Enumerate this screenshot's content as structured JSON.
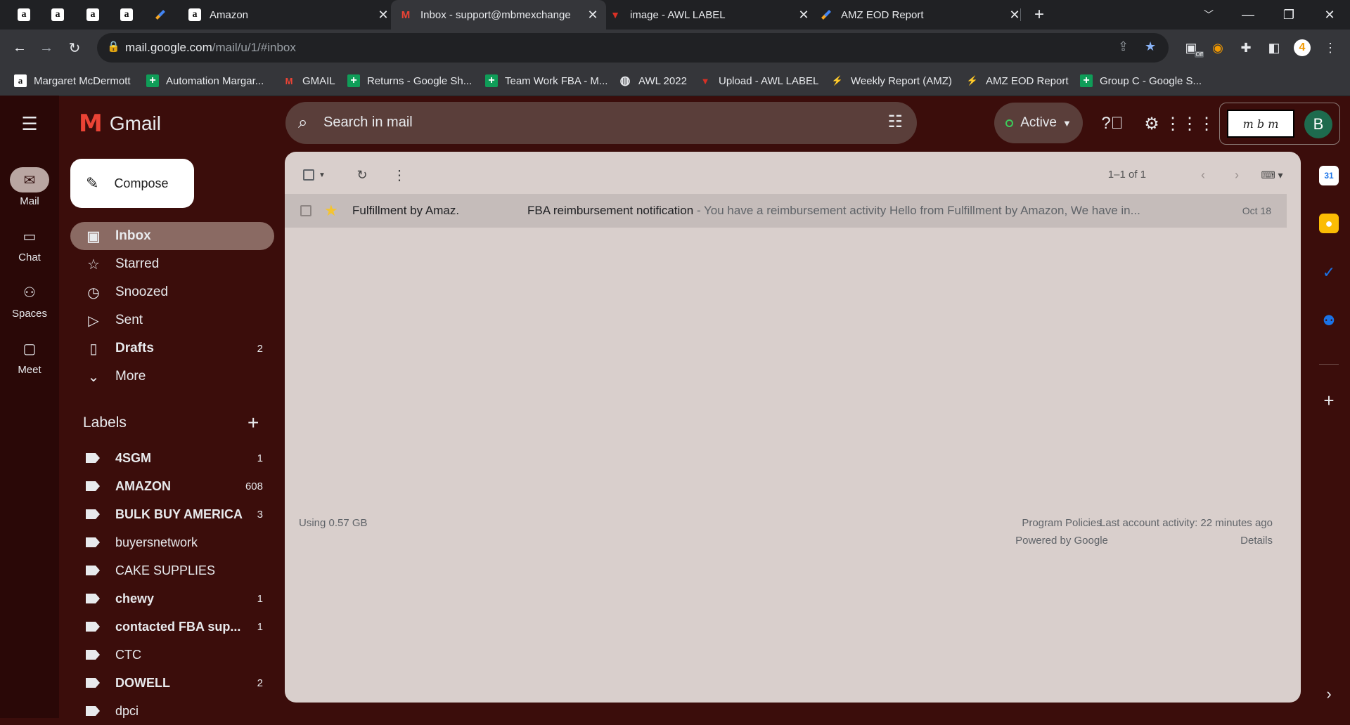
{
  "browser": {
    "pinned_tabs": [
      "amazon",
      "amazon",
      "amazon",
      "amazon",
      "zapier"
    ],
    "tabs": [
      {
        "title": "Amazon",
        "icon": "amazon-icon"
      },
      {
        "title": "Inbox - support@mbmexchange",
        "icon": "gmail-icon",
        "active": true
      },
      {
        "title": "image - AWL LABEL",
        "icon": "awl-icon"
      },
      {
        "title": "AMZ EOD Report",
        "icon": "zapier-icon"
      }
    ],
    "url_host": "mail.google.com",
    "url_path": "/mail/u/1/#inbox",
    "profile_badge": "4",
    "extension_badge": "Off",
    "bookmarks": [
      {
        "label": "Margaret McDermott",
        "icon": "amazon"
      },
      {
        "label": "Automation Margar...",
        "icon": "sheets"
      },
      {
        "label": "GMAIL",
        "icon": "gmail"
      },
      {
        "label": "Returns - Google Sh...",
        "icon": "sheets"
      },
      {
        "label": "Team Work FBA - M...",
        "icon": "sheets"
      },
      {
        "label": "AWL 2022",
        "icon": "globe"
      },
      {
        "label": "Upload - AWL LABEL",
        "icon": "awl"
      },
      {
        "label": "Weekly Report (AMZ)",
        "icon": "zap"
      },
      {
        "label": "AMZ EOD Report",
        "icon": "zap"
      },
      {
        "label": "Group C - Google S...",
        "icon": "sheets"
      }
    ]
  },
  "gmail": {
    "logo_text": "Gmail",
    "rail": [
      {
        "label": "Mail",
        "icon": "mail-icon",
        "active": true
      },
      {
        "label": "Chat",
        "icon": "chat-icon"
      },
      {
        "label": "Spaces",
        "icon": "spaces-icon"
      },
      {
        "label": "Meet",
        "icon": "meet-icon"
      }
    ],
    "search_placeholder": "Search in mail",
    "status": "Active",
    "avatar_letter": "B",
    "org_logo_text": "m b m",
    "compose_label": "Compose",
    "nav": [
      {
        "label": "Inbox",
        "icon": "inbox-icon",
        "count": "",
        "active": true
      },
      {
        "label": "Starred",
        "icon": "star-icon",
        "count": ""
      },
      {
        "label": "Snoozed",
        "icon": "clock-icon",
        "count": ""
      },
      {
        "label": "Sent",
        "icon": "send-icon",
        "count": ""
      },
      {
        "label": "Drafts",
        "icon": "draft-icon",
        "count": "2",
        "bold": true
      },
      {
        "label": "More",
        "icon": "chevron-down-icon",
        "count": ""
      }
    ],
    "labels_heading": "Labels",
    "labels": [
      {
        "label": "4SGM",
        "count": "1",
        "bold": true
      },
      {
        "label": "AMAZON",
        "count": "608",
        "bold": true
      },
      {
        "label": "BULK BUY AMERICA",
        "count": "3",
        "bold": true
      },
      {
        "label": "buyersnetwork",
        "count": ""
      },
      {
        "label": "CAKE SUPPLIES",
        "count": ""
      },
      {
        "label": "chewy",
        "count": "1",
        "bold": true
      },
      {
        "label": "contacted FBA sup...",
        "count": "1",
        "bold": true
      },
      {
        "label": "CTC",
        "count": ""
      },
      {
        "label": "DOWELL",
        "count": "2",
        "bold": true
      },
      {
        "label": "dpci",
        "count": ""
      }
    ],
    "pager": "1–1 of 1",
    "emails": [
      {
        "sender": "Fulfillment by Amaz.",
        "subject": "FBA reimbursement notification",
        "snippet": " - You have a reimbursement activity Hello from Fulfillment by Amazon, We have in...",
        "date": "Oct 18",
        "starred": true
      }
    ],
    "footer": {
      "storage": "Using 0.57 GB",
      "policies": "Program Policies",
      "powered": "Powered by Google",
      "activity": "Last account activity: 22 minutes ago",
      "details": "Details"
    }
  }
}
